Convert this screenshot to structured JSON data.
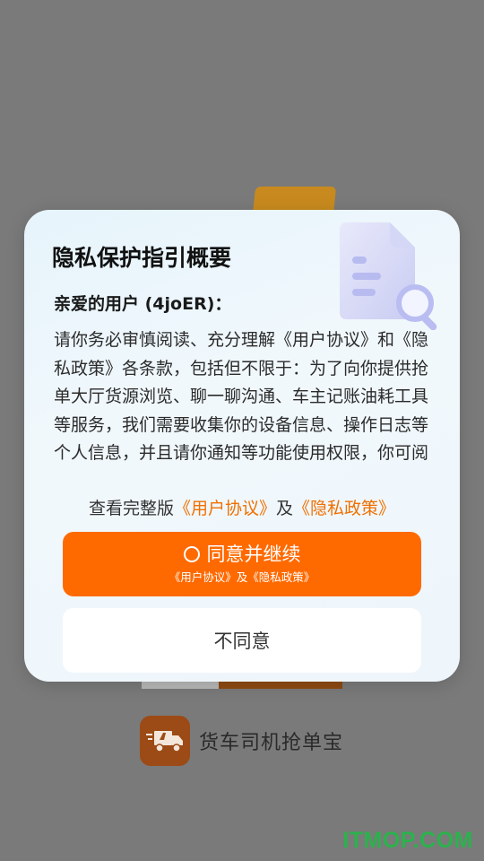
{
  "app": {
    "name": "货车司机抢单宝",
    "logo_icon": "truck-icon"
  },
  "dialog": {
    "title": "隐私保护指引概要",
    "illustration_icon": "document-search-icon",
    "greeting": "亲爱的用户 (4joER)：",
    "body": "请你务必审慎阅读、充分理解《用户协议》和《隐私政策》各条款，包括但不限于：为了向你提供抢单大厅货源浏览、聊一聊沟通、车主记账油耗工具等服务，我们需要收集你的设备信息、操作日志等个人信息，并且请你通知等功能使用权限，你可阅",
    "links": {
      "prefix": "查看完整版",
      "user_agreement": "《用户协议》",
      "joiner": "及",
      "privacy_policy": "《隐私政策》"
    },
    "agree_button": {
      "label": "同意并继续",
      "sublabel": "《用户协议》及《隐私政策》"
    },
    "disagree_button": {
      "label": "不同意"
    }
  },
  "watermark": "ITMOP.COM",
  "colors": {
    "accent": "#ff6a00",
    "link": "#f07000",
    "watermark": "#2bb24c"
  }
}
